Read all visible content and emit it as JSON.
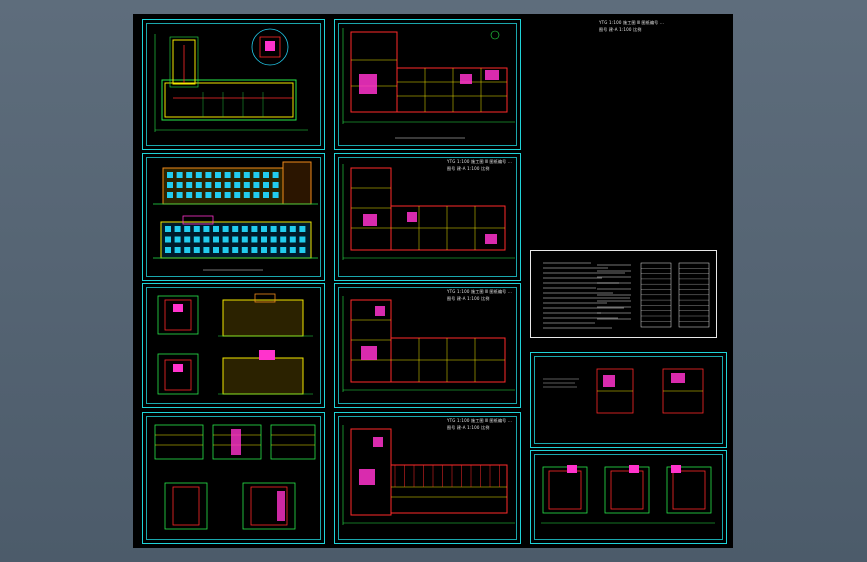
{
  "colors": {
    "viewport_bg": "#53626f",
    "sheet_bg": "#000000",
    "frame": "#1fd3d8",
    "wall_red": "#ff2a2a",
    "wall_yellow": "#f2e600",
    "line_green": "#27e84a",
    "hatch_magenta": "#ff33cc",
    "window_cyan": "#22ccee",
    "facade_orange": "#f08a1a",
    "text_white": "#e8e8e8"
  },
  "drawings": {
    "header_note_line1": "YTG 1:100  施工图 Ⅲ 图纸编号 ...",
    "header_note_line2": "图号 建-A  1:100 比例"
  }
}
